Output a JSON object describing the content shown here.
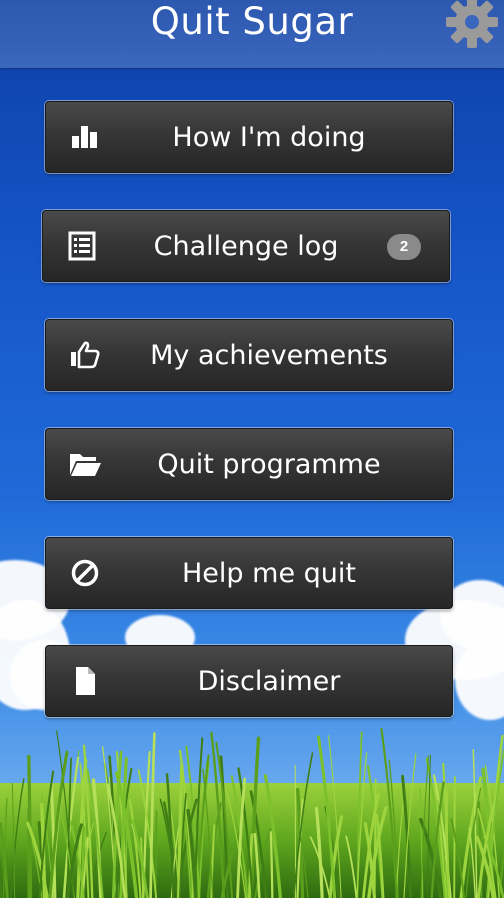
{
  "app": {
    "title": "Quit Sugar",
    "settings_icon": "gear-icon"
  },
  "menu": [
    {
      "label": "How I'm doing",
      "icon": "bar-chart-icon"
    },
    {
      "label": "Challenge log",
      "icon": "list-icon",
      "badge": "2"
    },
    {
      "label": "My achievements",
      "icon": "thumbs-up-icon"
    },
    {
      "label": "Quit programme",
      "icon": "folder-open-icon"
    },
    {
      "label": "Help me quit",
      "icon": "ban-icon"
    },
    {
      "label": "Disclaimer",
      "icon": "document-icon"
    }
  ],
  "colors": {
    "header": "#3b66bd",
    "button": "#363636",
    "badge": "#8a8a8a",
    "text": "#ffffff"
  }
}
